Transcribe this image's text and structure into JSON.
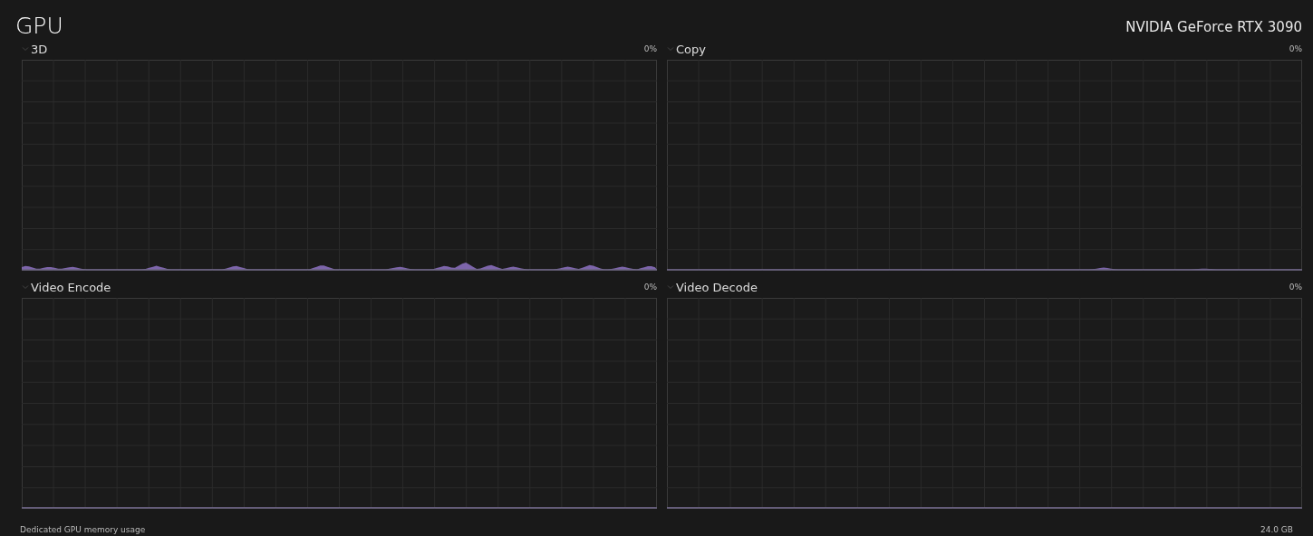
{
  "header": {
    "title": "GPU",
    "device": "NVIDIA GeForce RTX 3090"
  },
  "engines": [
    {
      "label": "3D",
      "reading": "0%"
    },
    {
      "label": "Copy",
      "reading": "0%"
    },
    {
      "label": "Video Encode",
      "reading": "0%"
    },
    {
      "label": "Video Decode",
      "reading": "0%"
    }
  ],
  "footer": {
    "label": "Dedicated GPU memory usage",
    "capacity": "24.0 GB"
  }
}
